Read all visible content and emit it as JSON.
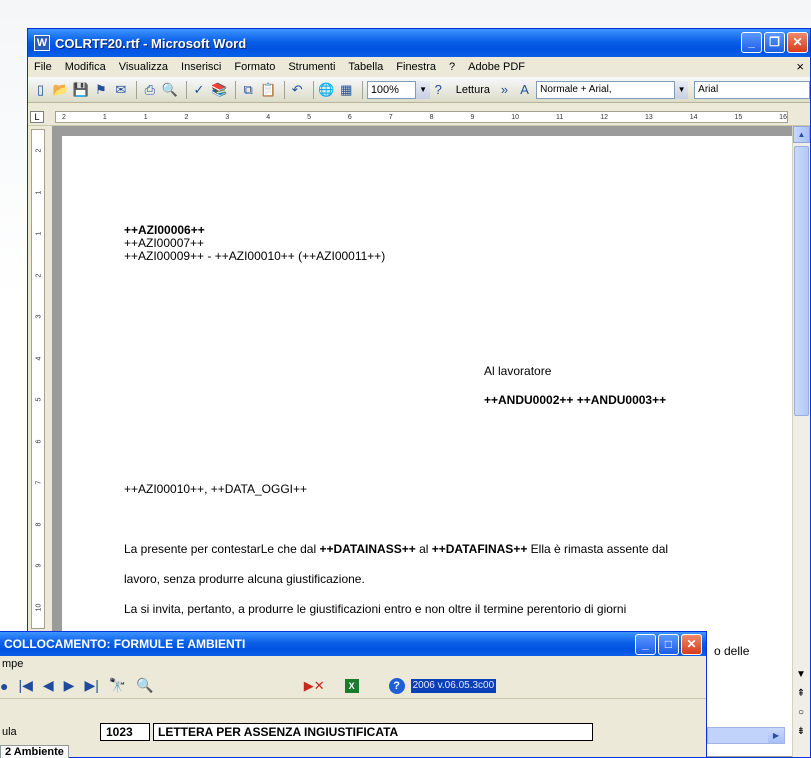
{
  "word": {
    "title": "COLRTF20.rtf - Microsoft Word",
    "app_icon": "W",
    "menus": [
      "File",
      "Modifica",
      "Visualizza",
      "Inserisci",
      "Formato",
      "Strumenti",
      "Tabella",
      "Finestra",
      "?",
      "Adobe PDF"
    ],
    "doc_close": "×",
    "zoom": "100%",
    "lettura": "Lettura",
    "style": "Normale + Arial,",
    "font": "Arial",
    "ruler_numbers": [
      "2",
      "1",
      "1",
      "2",
      "3",
      "4",
      "5",
      "6",
      "7",
      "8",
      "9",
      "10",
      "11",
      "12",
      "13",
      "14",
      "15",
      "16"
    ],
    "vruler_numbers": [
      "2",
      "1",
      "1",
      "2",
      "3",
      "4",
      "5",
      "6",
      "7",
      "8",
      "9",
      "10"
    ]
  },
  "document": {
    "line1": "++AZI00006++",
    "line2": "++AZI00007++",
    "line3": "++AZI00009++ - ++AZI00010++ (++AZI00011++)",
    "recipient_label": "Al lavoratore",
    "recipient_name": "++ANDU0002++ ++ANDU0003++",
    "place_date": "++AZI00010++, ++DATA_OGGI++",
    "para1_a": "La presente per contestarLe che dal ",
    "para1_b": "++DATAINASS++",
    "para1_c": " al ",
    "para1_d": "++DATAFINAS++",
    "para1_e": " Ella è rimasta assente dal",
    "para2": "lavoro, senza produrre alcuna giustificazione.",
    "para3": "La si invita, pertanto, a produrre le giustificazioni entro e non oltre il termine perentorio di   giorni",
    "fragment_right": "o delle"
  },
  "dialog": {
    "title": "COLLOCAMENTO: FORMULE E AMBIENTI",
    "menu": "mpe",
    "version": "2006 v.06.05.3c00",
    "label": "ula",
    "code": "1023",
    "name": "LETTERA PER ASSENZA INGIUSTIFICATA",
    "tab": "2 Ambiente"
  },
  "colors": {
    "xp_blue": "#0a5fe8",
    "chrome": "#ece9d8",
    "close_red": "#d73c1c"
  }
}
